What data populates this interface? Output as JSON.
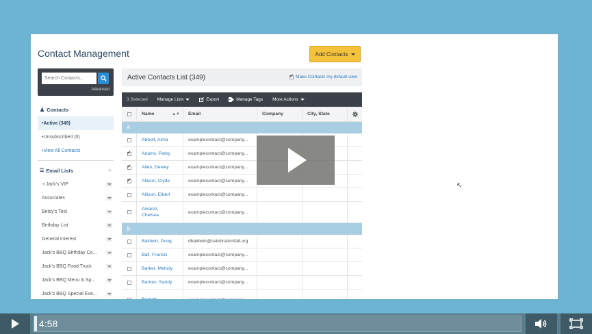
{
  "app": {
    "title": "Contact Management",
    "add_button": "Add Contacts",
    "search_placeholder": "Search Contacts...",
    "advanced_label": "Advanced"
  },
  "sidebar": {
    "contacts_heading": "Contacts",
    "contacts_items": [
      {
        "label": "Active (349)",
        "active": true
      },
      {
        "label": "Unsubscribed (0)"
      },
      {
        "label": "View All Contacts"
      }
    ],
    "email_lists_heading": "Email Lists",
    "email_lists": [
      "Jack's VIP",
      "Associates",
      "Betsy's Test",
      "Birthday List",
      "General Interest",
      "Jack's BBQ Birthday Co...",
      "Jack's BBQ Food Truck",
      "Jack's BBQ Menu & Sp...",
      "Jack's BBQ Special Eve..."
    ]
  },
  "list": {
    "title": "Active Contacts List (349)",
    "default_view_label": "Make Contacts my default view",
    "toolbar": {
      "selected": "3 Selected",
      "manage_lists": "Manage Lists",
      "export": "Export",
      "manage_tags": "Manage Tags",
      "more_actions": "More Actions"
    },
    "columns": [
      "Name",
      "Email",
      "Company",
      "City, State"
    ],
    "groups": [
      {
        "letter": "A",
        "rows": [
          {
            "name": "Abbott, Alma",
            "email": "examplecontact@company...",
            "checked": false
          },
          {
            "name": "Adams, Patsy",
            "email": "examplecontact@company...",
            "checked": true
          },
          {
            "name": "Allen, Dewey",
            "email": "examplecontact@company...",
            "checked": true
          },
          {
            "name": "Allison, Clyde",
            "email": "examplecontact@company...",
            "checked": true
          },
          {
            "name": "Allison, Elbert",
            "email": "examplecontact@company...",
            "checked": false
          },
          {
            "name": "Alvarez, Chelsea",
            "email": "examplecontact@company...",
            "checked": false,
            "tall": true
          }
        ]
      },
      {
        "letter": "B",
        "rows": [
          {
            "name": "Baldwin, Doug",
            "email": "dbaldwin@celebrationfall.org",
            "checked": false
          },
          {
            "name": "Ball, Francis",
            "email": "examplecontact@company...",
            "checked": false
          },
          {
            "name": "Barker, Melody",
            "email": "examplecontact@company...",
            "checked": false
          },
          {
            "name": "Barnes, Sandy",
            "email": "examplecontact@company...",
            "checked": false
          },
          {
            "name": "Barnett,",
            "email": "examplecontact@company...",
            "checked": false,
            "tall": true
          }
        ]
      }
    ]
  },
  "player": {
    "time": "4:58",
    "progress": 0.005,
    "icons": [
      "play-icon",
      "volume-icon",
      "fullscreen-icon"
    ]
  }
}
